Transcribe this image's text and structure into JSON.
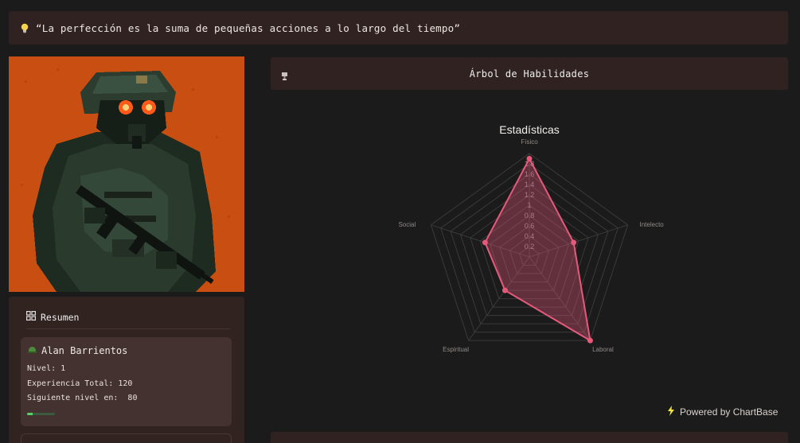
{
  "quote": {
    "icon": "lightbulb-icon",
    "text": "“La perfección es la suma de pequeñas acciones a lo largo del tiempo”"
  },
  "avatar": {
    "description_icon": "soldier-pixel-avatar"
  },
  "summary": {
    "title": "Resumen",
    "player": {
      "name": "Alan Barrientos",
      "level_line": "Nivel: 1",
      "xp_line": "Experiencia Total: 120",
      "next_line": "Siguiente nivel en:  80",
      "progress": 0.2
    }
  },
  "skills": {
    "title": "Árbol de Habilidades",
    "icon": "trophy-icon"
  },
  "chart_data": {
    "type": "radar",
    "title": "Estadísticas",
    "categories": [
      "Físico",
      "Intelecto",
      "Laboral",
      "Espiritual",
      "Social"
    ],
    "values": [
      1.9,
      0.9,
      2.0,
      0.8,
      0.9
    ],
    "rlim": [
      0,
      2
    ],
    "ticks": [
      "0.2",
      "0.4",
      "0.6",
      "0.8",
      "1",
      "1.2",
      "1.4",
      "1.6",
      "1.8"
    ],
    "color": "#e55a7b"
  },
  "footer": {
    "powered_by": "Powered by ChartBase",
    "icon": "lightning-icon"
  }
}
